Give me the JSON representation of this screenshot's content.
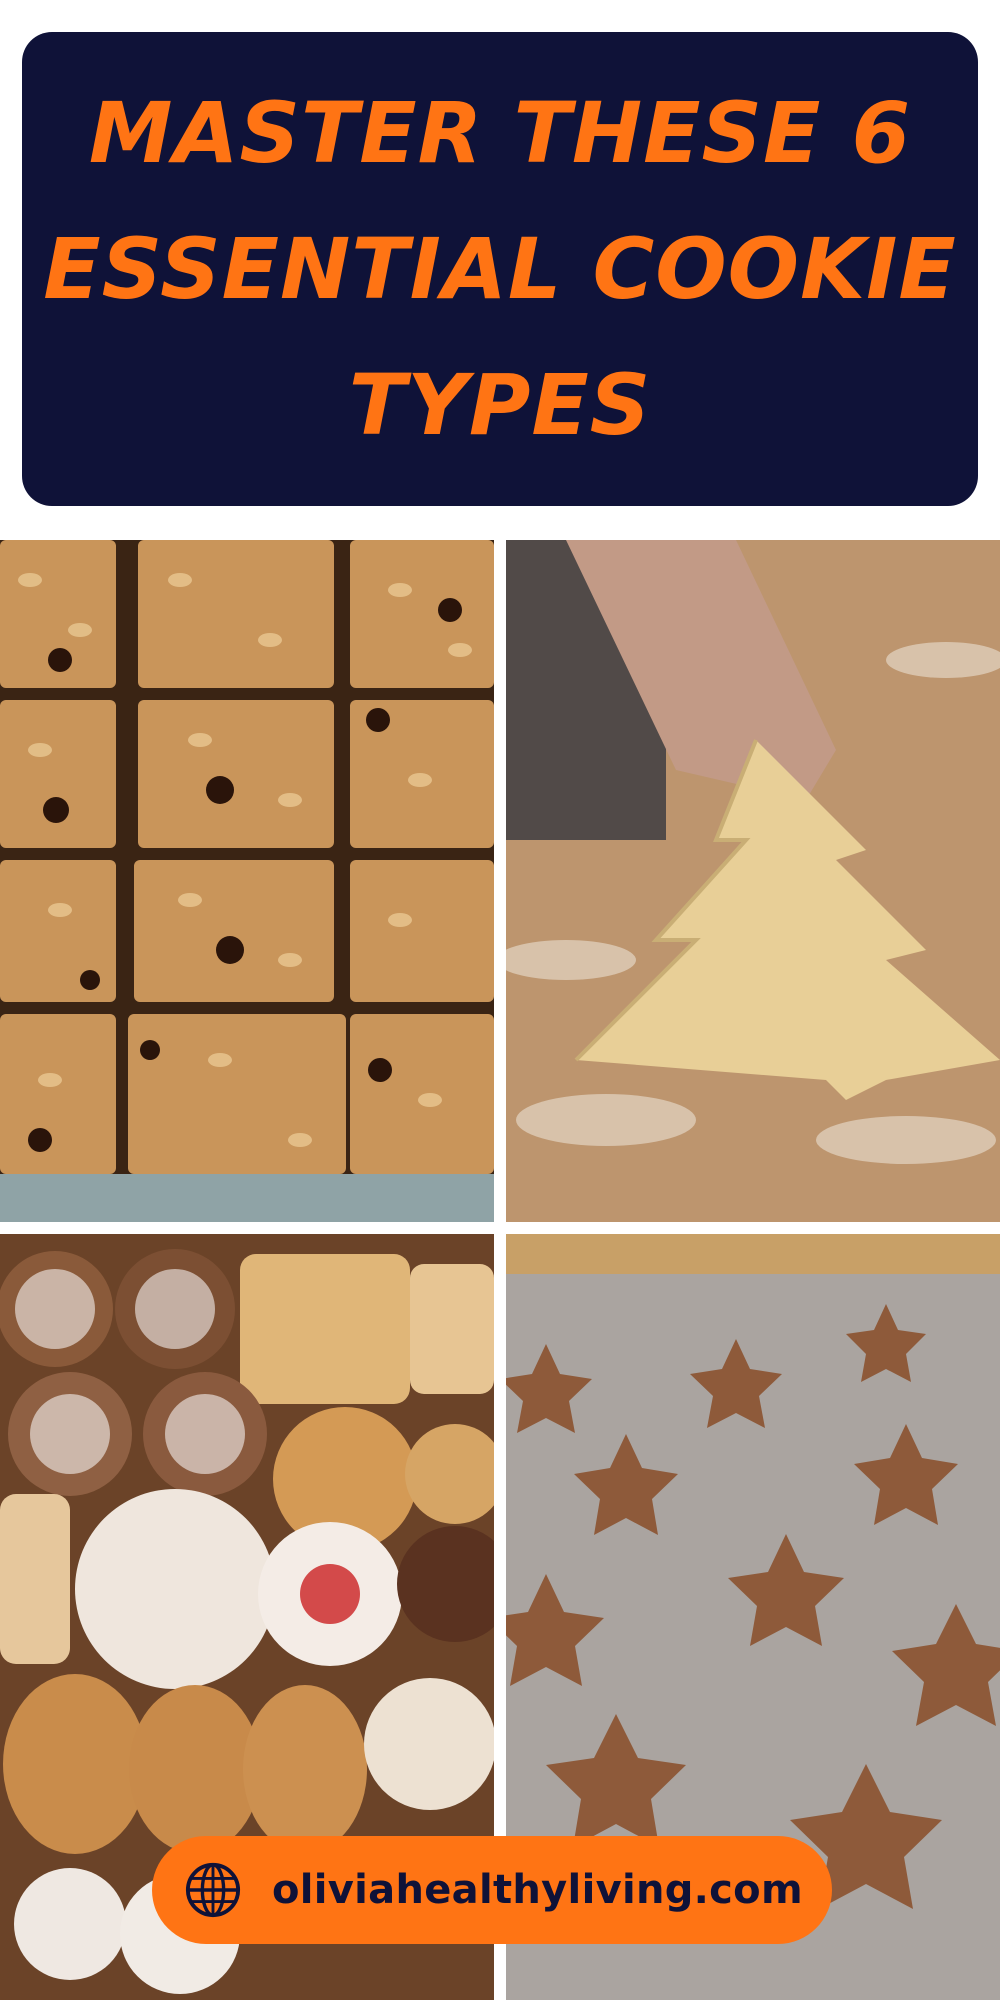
{
  "header": {
    "line1": "MASTER THESE 6",
    "line2": "ESSENTIAL COOKIE",
    "line3": "TYPES"
  },
  "photos": [
    {
      "icon": "oatmeal-chocolate-chip-bars-photo"
    },
    {
      "icon": "tree-cookie-dough-photo"
    },
    {
      "icon": "assorted-cookies-photo"
    },
    {
      "icon": "chocolate-star-cookies-photo"
    }
  ],
  "footer": {
    "url": "oliviahealthyliving.com",
    "icon": "globe-icon"
  },
  "colors": {
    "banner_bg": "#0f1238",
    "accent": "#ff7414",
    "background": "#ffffff"
  }
}
